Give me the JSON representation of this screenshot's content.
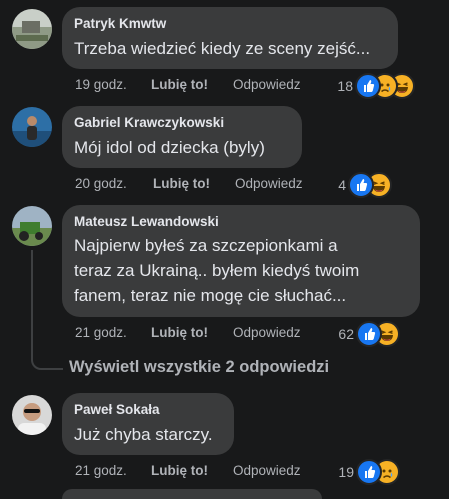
{
  "comments": [
    {
      "author": "Patryk Kmwtw",
      "text": "Trzeba wiedzieć kiedy ze sceny zejść...",
      "time": "19 godz.",
      "like_label": "Lubię to!",
      "reply_label": "Odpowiedz",
      "reaction_count": "18",
      "reactions": [
        "like-icon",
        "sad-icon",
        "haha-icon"
      ],
      "avatar": "avatar-landscape"
    },
    {
      "author": "Gabriel Krawczykowski",
      "text": "Mój idol od dziecka (byly)",
      "time": "20 godz.",
      "like_label": "Lubię to!",
      "reply_label": "Odpowiedz",
      "reaction_count": "4",
      "reactions": [
        "like-icon",
        "haha-icon"
      ],
      "avatar": "avatar-person-sea"
    },
    {
      "author": "Mateusz Lewandowski",
      "text_lines": [
        "Najpierw byłeś za szczepionkami a",
        "teraz za Ukrainą.. byłem kiedyś twoim",
        "fanem, teraz nie mogę cie słuchać..."
      ],
      "time": "21 godz.",
      "like_label": "Lubię to!",
      "reply_label": "Odpowiedz",
      "reaction_count": "62",
      "reactions": [
        "like-icon",
        "haha-icon"
      ],
      "avatar": "avatar-tractor",
      "view_replies": "Wyświetl wszystkie 2 odpowiedzi"
    },
    {
      "author": "Paweł Sokała",
      "text": "Już chyba starczy.",
      "time": "21 godz.",
      "like_label": "Lubię to!",
      "reply_label": "Odpowiedz",
      "reaction_count": "19",
      "reactions": [
        "like-icon",
        "sad-icon"
      ],
      "avatar": "avatar-man-sunglasses"
    }
  ],
  "colors": {
    "background": "#18191a",
    "bubble": "#3a3b3c",
    "secondary_text": "#b0b3b8",
    "like_blue": "#1877f2",
    "emoji_yellow": "#f7b125"
  }
}
